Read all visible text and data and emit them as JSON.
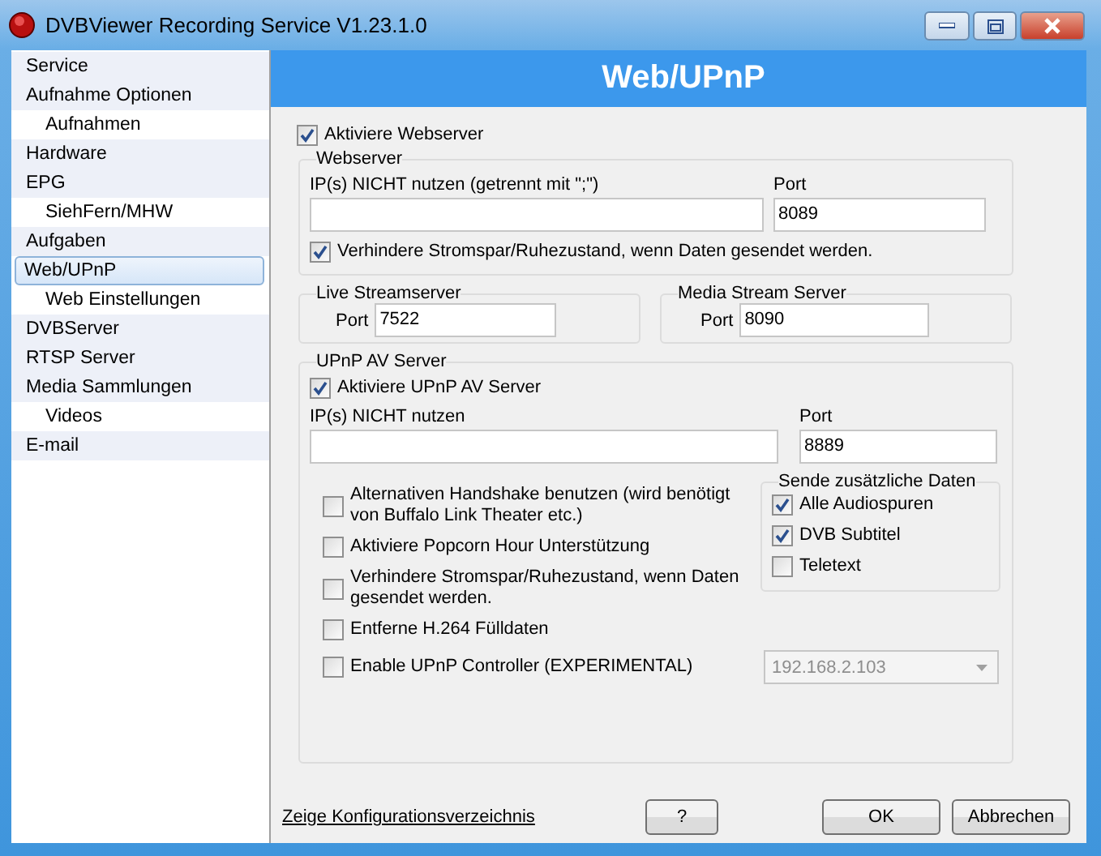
{
  "window": {
    "title": "DVBViewer Recording Service V1.23.1.0"
  },
  "sidebar": {
    "items": [
      {
        "label": "Service",
        "selected": false
      },
      {
        "label": "Aufnahme Optionen",
        "selected": false,
        "children": [
          {
            "label": "Aufnahmen",
            "selected": false
          }
        ]
      },
      {
        "label": "Hardware",
        "selected": false
      },
      {
        "label": "EPG",
        "selected": false,
        "children": [
          {
            "label": "SiehFern/MHW",
            "selected": false
          }
        ]
      },
      {
        "label": "Aufgaben",
        "selected": false
      },
      {
        "label": "Web/UPnP",
        "selected": true,
        "children": [
          {
            "label": "Web Einstellungen",
            "selected": false
          }
        ]
      },
      {
        "label": "DVBServer",
        "selected": false
      },
      {
        "label": "RTSP Server",
        "selected": false
      },
      {
        "label": "Media Sammlungen",
        "selected": false,
        "children": [
          {
            "label": "Videos",
            "selected": false
          }
        ]
      },
      {
        "label": "E-mail",
        "selected": false
      }
    ]
  },
  "header": {
    "title": "Web/UPnP"
  },
  "enable_webserver": {
    "label": "Aktiviere Webserver",
    "checked": true
  },
  "webserver": {
    "title": "Webserver",
    "ip_label": "IP(s) NICHT nutzen (getrennt mit \";\")",
    "port_label": "Port",
    "port": "8089",
    "prevent_sleep": {
      "label": "Verhindere Stromspar/Ruhezustand, wenn Daten gesendet werden.",
      "checked": true
    }
  },
  "live_stream": {
    "title": "Live Streamserver",
    "port_label": "Port",
    "port": "7522"
  },
  "media_stream": {
    "title": "Media Stream Server",
    "port_label": "Port",
    "port": "8090"
  },
  "upnp": {
    "title": "UPnP AV Server",
    "enable": {
      "label": "Aktiviere UPnP AV Server",
      "checked": true
    },
    "ip_label": "IP(s) NICHT nutzen",
    "port_label": "Port",
    "port": "8889",
    "options": [
      {
        "label": "Alternativen Handshake benutzen (wird benötigt von Buffalo Link Theater etc.)",
        "checked": false
      },
      {
        "label": "Aktiviere Popcorn Hour Unterstützung",
        "checked": false
      },
      {
        "label": "Verhindere Stromspar/Ruhezustand, wenn Daten gesendet werden.",
        "checked": false
      },
      {
        "label": "Entferne H.264 Fülldaten",
        "checked": false
      },
      {
        "label": "Enable UPnP Controller (EXPERIMENTAL)",
        "checked": false
      }
    ],
    "extra_data": {
      "title": "Sende zusätzliche Daten",
      "options": [
        {
          "label": "Alle Audiospuren",
          "checked": true
        },
        {
          "label": "DVB Subtitel",
          "checked": true
        },
        {
          "label": "Teletext",
          "checked": false
        }
      ]
    },
    "controller_address": {
      "value": "192.168.2.103",
      "disabled": true
    }
  },
  "footer": {
    "link": "Zeige Konfigurationsverzeichnis",
    "help_button": "?",
    "ok_button": "OK",
    "cancel_button": "Abbrechen"
  }
}
